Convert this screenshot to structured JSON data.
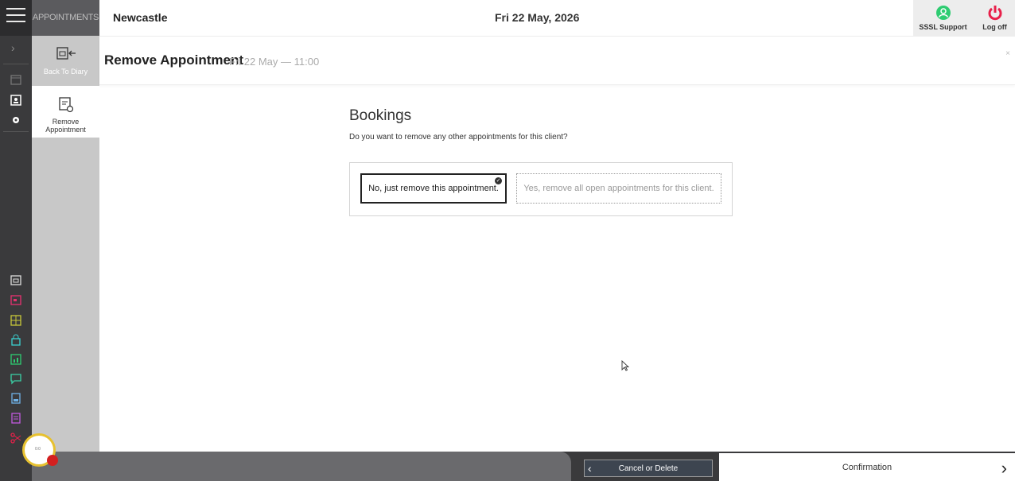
{
  "header": {
    "module": "APPOINTMENTS",
    "location": "Newcastle",
    "date": "Fri 22 May, 2026",
    "support_label": "SSSL Support",
    "logoff_label": "Log off"
  },
  "sidebar": {
    "items": [
      {
        "label": "Back To Diary"
      },
      {
        "label": "Remove Appointment"
      }
    ]
  },
  "page": {
    "title": "Remove Appointment",
    "meta": "Fri 22 May — 11:00",
    "close": "×"
  },
  "bookings": {
    "title": "Bookings",
    "question": "Do you want to remove any other appointments for this client?",
    "option_no": "No, just remove this appointment.",
    "option_yes": "Yes, remove all open appointments for this client."
  },
  "footer": {
    "cancel": "Cancel or Delete",
    "confirm": "Confirmation"
  },
  "recorder": {
    "label": "0:0"
  },
  "colors": {
    "rail": "#3a3a3c",
    "support": "#2ecc71",
    "logoff": "#e8204a"
  }
}
